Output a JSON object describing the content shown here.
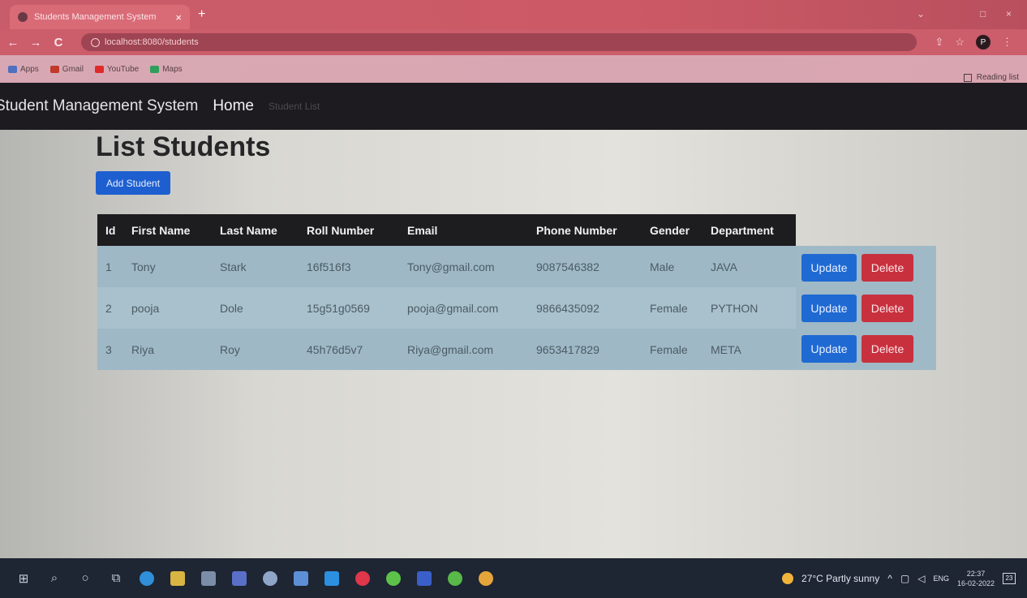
{
  "browser": {
    "tab_title": "Students Management System",
    "tab_close": "×",
    "new_tab": "+",
    "url": "localhost:8080/students",
    "back": "←",
    "forward": "→",
    "reload": "C",
    "window_minimize": "⌄",
    "window_restore": "□",
    "window_close": "×",
    "profile_initial": "P",
    "bookmarks": [
      {
        "label": "Apps",
        "icon_color": "#4f6fc0"
      },
      {
        "label": "Gmail",
        "icon_color": "#c0392b"
      },
      {
        "label": "YouTube",
        "icon_color": "#e02a2a"
      },
      {
        "label": "Maps",
        "icon_color": "#2f9e5a"
      }
    ],
    "reading_list": "Reading list"
  },
  "navbar": {
    "brand": "Student Management System",
    "home": "Home",
    "student_list": "Student List"
  },
  "page": {
    "title": "List Students",
    "add_button": "Add Student"
  },
  "table": {
    "headers": [
      "Id",
      "First Name",
      "Last Name",
      "Roll Number",
      "Email",
      "Phone Number",
      "Gender",
      "Department"
    ],
    "rows": [
      [
        "1",
        "Tony",
        "Stark",
        "16f516f3",
        "Tony@gmail.com",
        "9087546382",
        "Male",
        "JAVA"
      ],
      [
        "2",
        "pooja",
        "Dole",
        "15g51g0569",
        "pooja@gmail.com",
        "9866435092",
        "Female",
        "PYTHON"
      ],
      [
        "3",
        "Riya",
        "Roy",
        "45h76d5v7",
        "Riya@gmail.com",
        "9653417829",
        "Female",
        "META"
      ]
    ],
    "update_label": "Update",
    "delete_label": "Delete"
  },
  "taskbar": {
    "weather": "27°C  Partly sunny",
    "language": "ENG",
    "time": "22:37",
    "date": "16-02-2022",
    "notification_count": "23",
    "apps": [
      {
        "name": "edge",
        "color": "#2f8fd8"
      },
      {
        "name": "file-explorer",
        "color": "#d8b443"
      },
      {
        "name": "store",
        "color": "#7c8da8"
      },
      {
        "name": "teams",
        "color": "#5a6fc8"
      },
      {
        "name": "app",
        "color": "#8fa6c8"
      },
      {
        "name": "notepad",
        "color": "#5d8fd6"
      },
      {
        "name": "vscode",
        "color": "#2d8fe0"
      },
      {
        "name": "opera",
        "color": "#e0364a"
      },
      {
        "name": "app",
        "color": "#5cc24a"
      },
      {
        "name": "word",
        "color": "#3a5fc8"
      },
      {
        "name": "app",
        "color": "#58b848"
      },
      {
        "name": "chrome",
        "color": "#e5a53a"
      }
    ]
  }
}
